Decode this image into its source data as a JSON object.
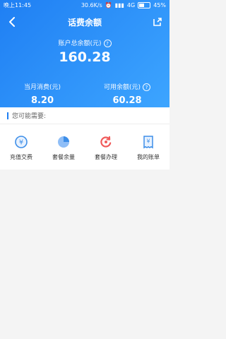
{
  "statusbar": {
    "time": "晚上11:45",
    "network": "30.6K/s",
    "signal": "4G",
    "battery": "45%"
  },
  "header": {
    "title": "话费余额",
    "total_label": "账户总余额(元)",
    "total_value": "160.28",
    "monthly_label": "当月消费(元)",
    "monthly_value": "8.20",
    "available_label": "可用余额(元)",
    "available_value": "60.28"
  },
  "section": {
    "title": "您可能需要:",
    "items": [
      {
        "label": "充值交费",
        "icon": "yen-circle-icon"
      },
      {
        "label": "套餐余量",
        "icon": "pie-chart-icon"
      },
      {
        "label": "套餐办理",
        "icon": "refresh-icon"
      },
      {
        "label": "我的账单",
        "icon": "bill-icon"
      }
    ]
  },
  "colors": {
    "primary": "#1f7ff3",
    "accent_red": "#f05a5a",
    "icon_blue": "#3d8ee8"
  }
}
